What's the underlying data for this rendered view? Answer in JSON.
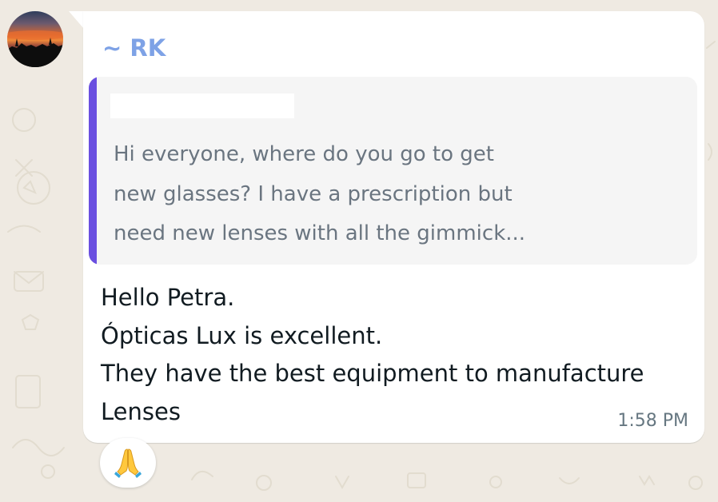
{
  "message": {
    "sender": "~ RK",
    "quote": {
      "author": "",
      "lines": [
        "Hi everyone, where do you go to get",
        "new glasses? I have a prescription but",
        "need new lenses with all the gimmick..."
      ]
    },
    "body_lines": [
      "Hello Petra.",
      "Ópticas Lux is excellent.",
      "They have the best equipment to manufacture",
      "Lenses"
    ],
    "time": "1:58 PM",
    "reaction": "praying-hands-emoji"
  },
  "colors": {
    "sender": "#7ea2e6",
    "quote_bar": "#6a4fe0",
    "chat_background": "#efeae2"
  }
}
